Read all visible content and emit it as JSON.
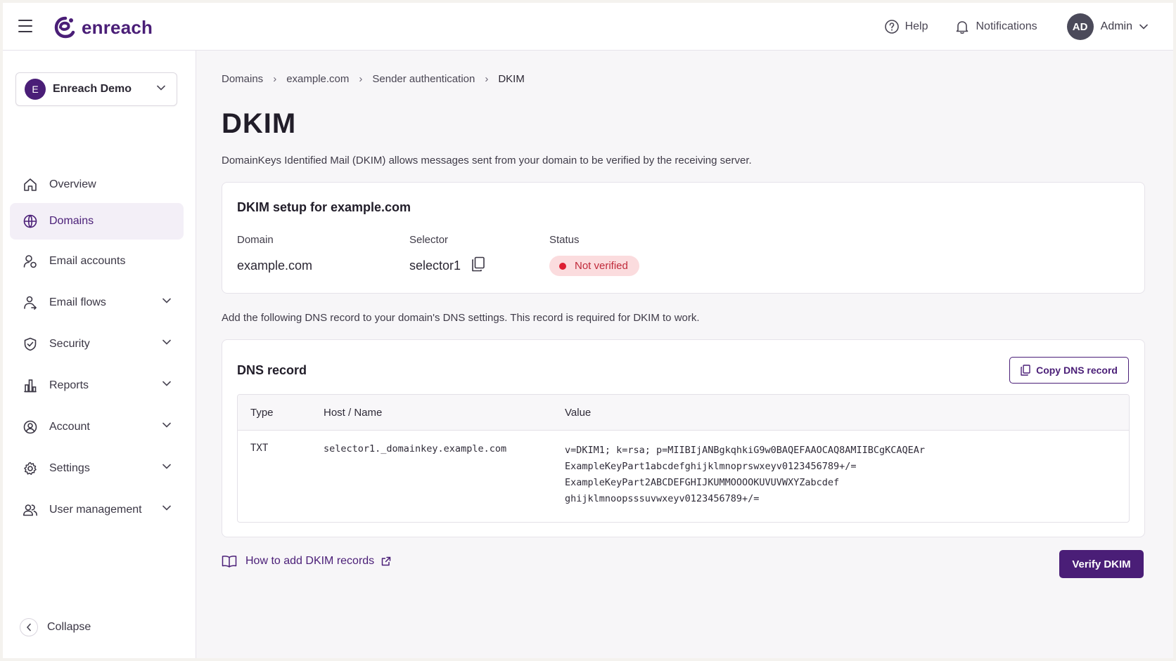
{
  "brand": {
    "name": "enreach",
    "color": "#4a1e77"
  },
  "topbar": {
    "help_label": "Help",
    "notifications_label": "Notifications",
    "user_initials": "AD",
    "user_name": "Admin"
  },
  "sidebar": {
    "workspace": {
      "initial": "E",
      "name": "Enreach Demo"
    },
    "items": [
      {
        "label": "Overview",
        "icon": "home-icon",
        "active": false,
        "expandable": false
      },
      {
        "label": "Domains",
        "icon": "globe-icon",
        "active": true,
        "expandable": false
      },
      {
        "label": "Email accounts",
        "icon": "user-mail-icon",
        "active": false,
        "expandable": false
      },
      {
        "label": "Email flows",
        "icon": "flow-icon",
        "active": false,
        "expandable": true
      },
      {
        "label": "Security",
        "icon": "shield-icon",
        "active": false,
        "expandable": true
      },
      {
        "label": "Reports",
        "icon": "bar-chart-icon",
        "active": false,
        "expandable": true
      },
      {
        "label": "Account",
        "icon": "user-circle-icon",
        "active": false,
        "expandable": true
      },
      {
        "label": "Settings",
        "icon": "gear-icon",
        "active": false,
        "expandable": true
      },
      {
        "label": "User management",
        "icon": "users-icon",
        "active": false,
        "expandable": true
      }
    ],
    "collapse_label": "Collapse"
  },
  "breadcrumb": [
    "Domains",
    "example.com",
    "Sender authentication",
    "DKIM"
  ],
  "page": {
    "title": "DKIM",
    "description": "DomainKeys Identified Mail (DKIM) allows messages sent from your domain to be verified by the receiving server."
  },
  "setup": {
    "title": "DKIM setup for example.com",
    "domain_label": "Domain",
    "domain_value": "example.com",
    "selector_label": "Selector",
    "selector_value": "selector1",
    "status_label": "Status",
    "status_value": "Not verified",
    "status_color": "#dd1f33"
  },
  "dns": {
    "intro": "Add the following DNS record to your domain's DNS settings. This record is required for DKIM to work.",
    "title": "DNS record",
    "copy_label": "Copy DNS record",
    "columns": [
      "Type",
      "Host / Name",
      "Value"
    ],
    "record": {
      "type": "TXT",
      "host": "selector1._domainkey.example.com",
      "value_lines": [
        "v=DKIM1; k=rsa; p=MIIBIjANBgkqhkiG9w0BAQEFAAOCAQ8AMIIBCgKCAQEAr",
        "ExampleKeyPart1abcdefghijklmnoprswxeyv0123456789+/=",
        "ExampleKeyPart2ABCDEFGHIJKUMMOOOOKUVUVWXYZabcdef",
        "ghijklmnoopsssuvwxeyv0123456789+/="
      ]
    }
  },
  "help_link": "How to add DKIM records",
  "verify_label": "Verify DKIM"
}
